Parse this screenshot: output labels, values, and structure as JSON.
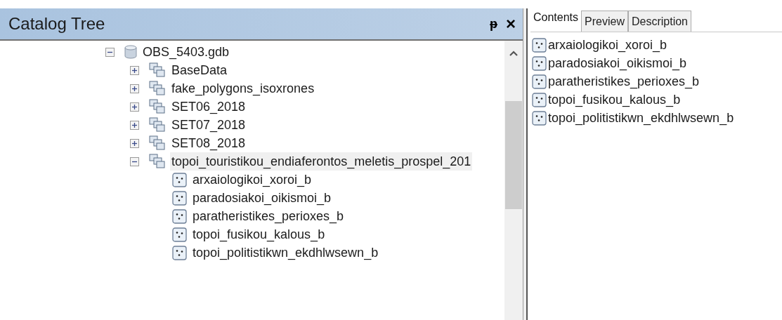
{
  "catalog_tree": {
    "title": "Catalog Tree",
    "pin_button": "ᵽ",
    "close_button": "×",
    "tree": [
      {
        "label": "OBS_5403.gdb",
        "kind": "database",
        "expanded": true,
        "selected": false,
        "children": [
          {
            "label": "BaseData",
            "kind": "dataset",
            "expanded": false,
            "selected": false
          },
          {
            "label": "fake_polygons_isoxrones",
            "kind": "dataset",
            "expanded": false,
            "selected": false
          },
          {
            "label": "SET06_2018",
            "kind": "dataset",
            "expanded": false,
            "selected": false
          },
          {
            "label": "SET07_2018",
            "kind": "dataset",
            "expanded": false,
            "selected": false
          },
          {
            "label": "SET08_2018",
            "kind": "dataset",
            "expanded": false,
            "selected": false
          },
          {
            "label": "topoi_touristikou_endiaferontos_meletis_prospel_201",
            "kind": "dataset",
            "expanded": true,
            "selected": true,
            "children": [
              {
                "label": "arxaiologikoi_xoroi_b",
                "kind": "point",
                "selected": false
              },
              {
                "label": "paradosiakoi_oikismoi_b",
                "kind": "point",
                "selected": false
              },
              {
                "label": "paratheristikes_perioxes_b",
                "kind": "point",
                "selected": false
              },
              {
                "label": "topoi_fusikou_kalous_b",
                "kind": "point",
                "selected": false
              },
              {
                "label": "topoi_politistikwn_ekdhlwsewn_b",
                "kind": "point",
                "selected": false
              }
            ]
          }
        ]
      }
    ]
  },
  "contents_panel": {
    "tabs": [
      {
        "label": "Contents",
        "selected": true
      },
      {
        "label": "Preview",
        "selected": false
      },
      {
        "label": "Description",
        "selected": false
      }
    ],
    "items": [
      {
        "label": "arxaiologikoi_xoroi_b",
        "kind": "point"
      },
      {
        "label": "paradosiakoi_oikismoi_b",
        "kind": "point"
      },
      {
        "label": "paratheristikes_perioxes_b",
        "kind": "point"
      },
      {
        "label": "topoi_fusikou_kalous_b",
        "kind": "point"
      },
      {
        "label": "topoi_politistikwn_ekdhlwsewn_b",
        "kind": "point"
      }
    ]
  }
}
